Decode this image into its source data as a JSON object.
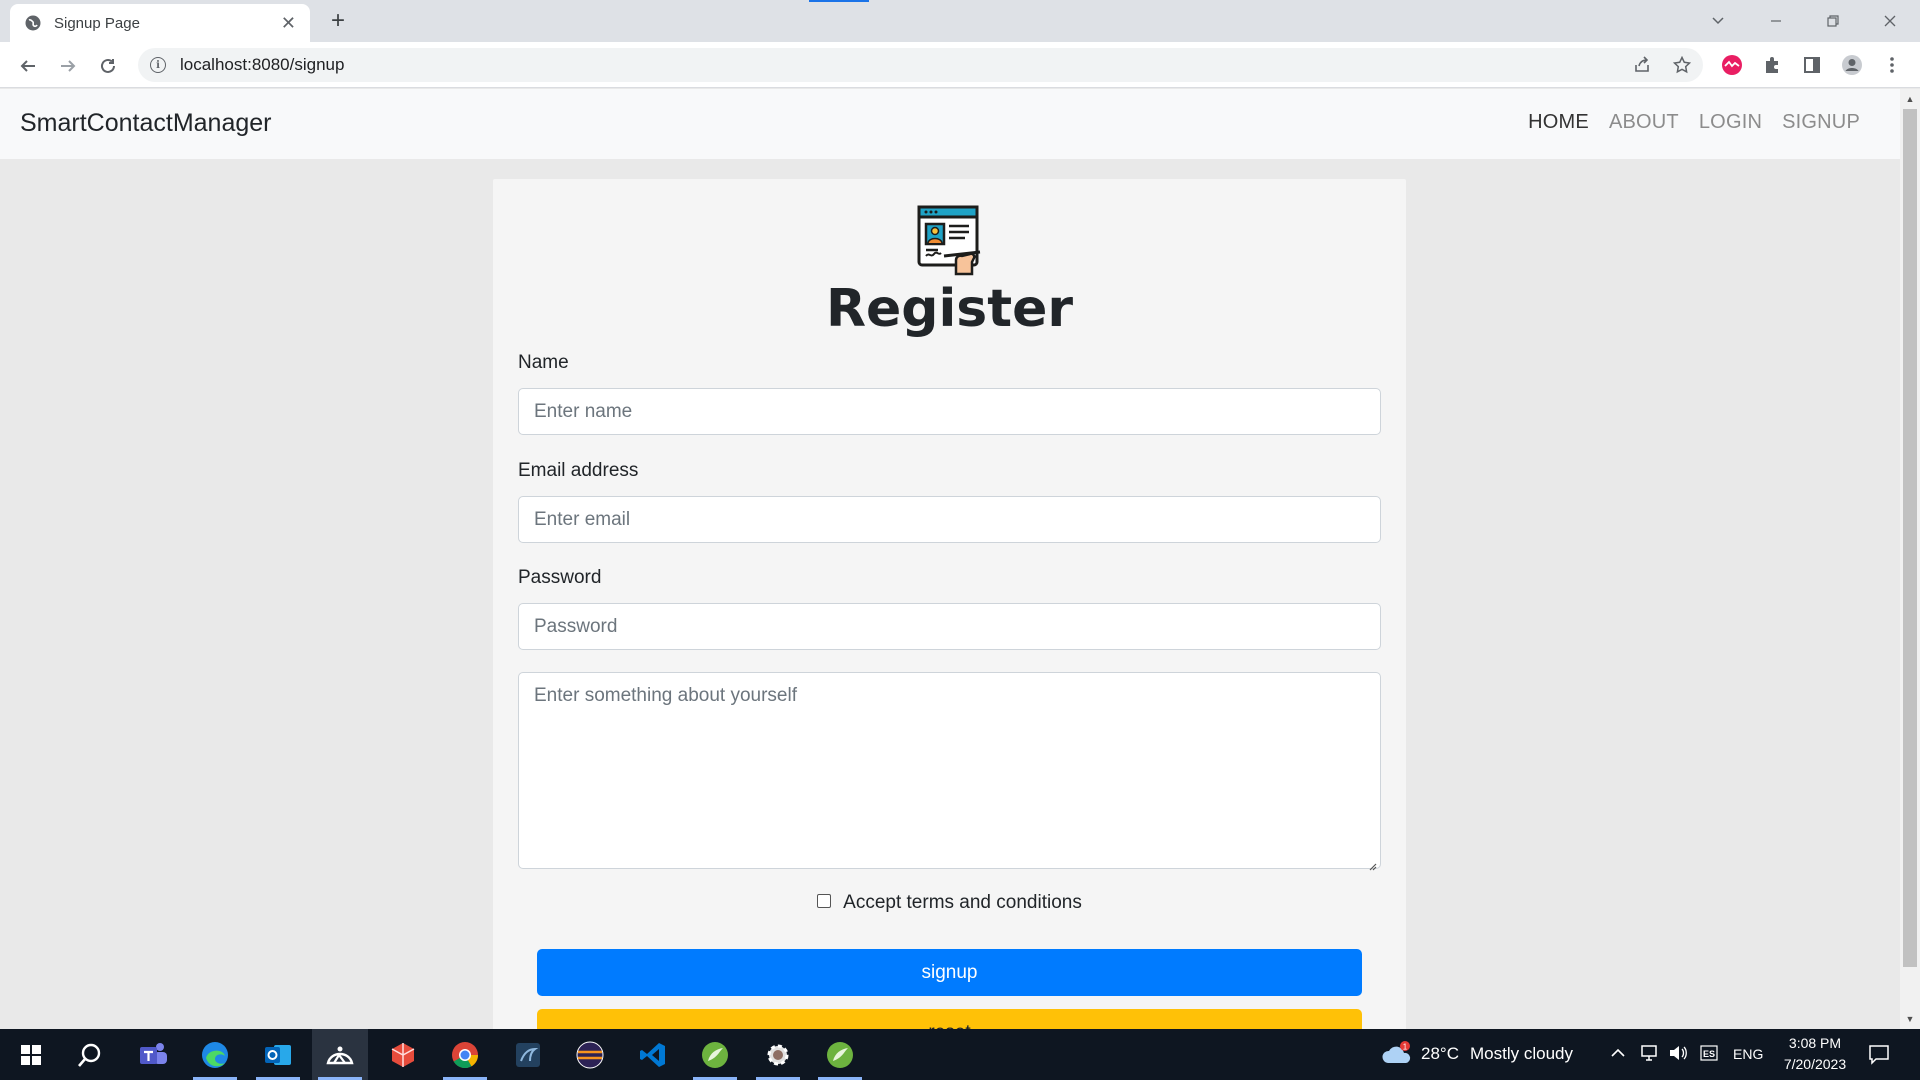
{
  "browser": {
    "tab_title": "Signup Page",
    "tab_close": "✕",
    "new_tab": "+",
    "url": "localhost:8080/signup"
  },
  "navbar": {
    "brand": "SmartContactManager",
    "links": [
      "HOME",
      "ABOUT",
      "LOGIN",
      "SIGNUP"
    ]
  },
  "form": {
    "heading": "Register",
    "name_label": "Name",
    "name_placeholder": "Enter name",
    "email_label": "Email address",
    "email_placeholder": "Enter email",
    "password_label": "Password",
    "password_placeholder": "Password",
    "about_placeholder": "Enter something about yourself",
    "terms_label": "Accept terms and conditions",
    "terms_checked": false,
    "signup_label": "signup",
    "reset_label": "reset"
  },
  "colors": {
    "primary": "#007bff",
    "warning": "#ffc107",
    "navbar_bg": "#f8f9fa",
    "page_bg": "#e9e9e9"
  },
  "taskbar": {
    "weather_temp": "28°C",
    "weather_desc": "Mostly cloudy",
    "language": "ENG",
    "time": "3:08 PM",
    "date": "7/20/2023",
    "apps": [
      "start-icon",
      "search-icon",
      "teams-icon",
      "edge-icon",
      "outlook-icon",
      "photos-icon",
      "office-icon",
      "chrome-icon",
      "mysql-icon",
      "eclipse-icon",
      "vscode-icon",
      "spring-icon",
      "settings-icon",
      "spring-tool-icon"
    ]
  }
}
